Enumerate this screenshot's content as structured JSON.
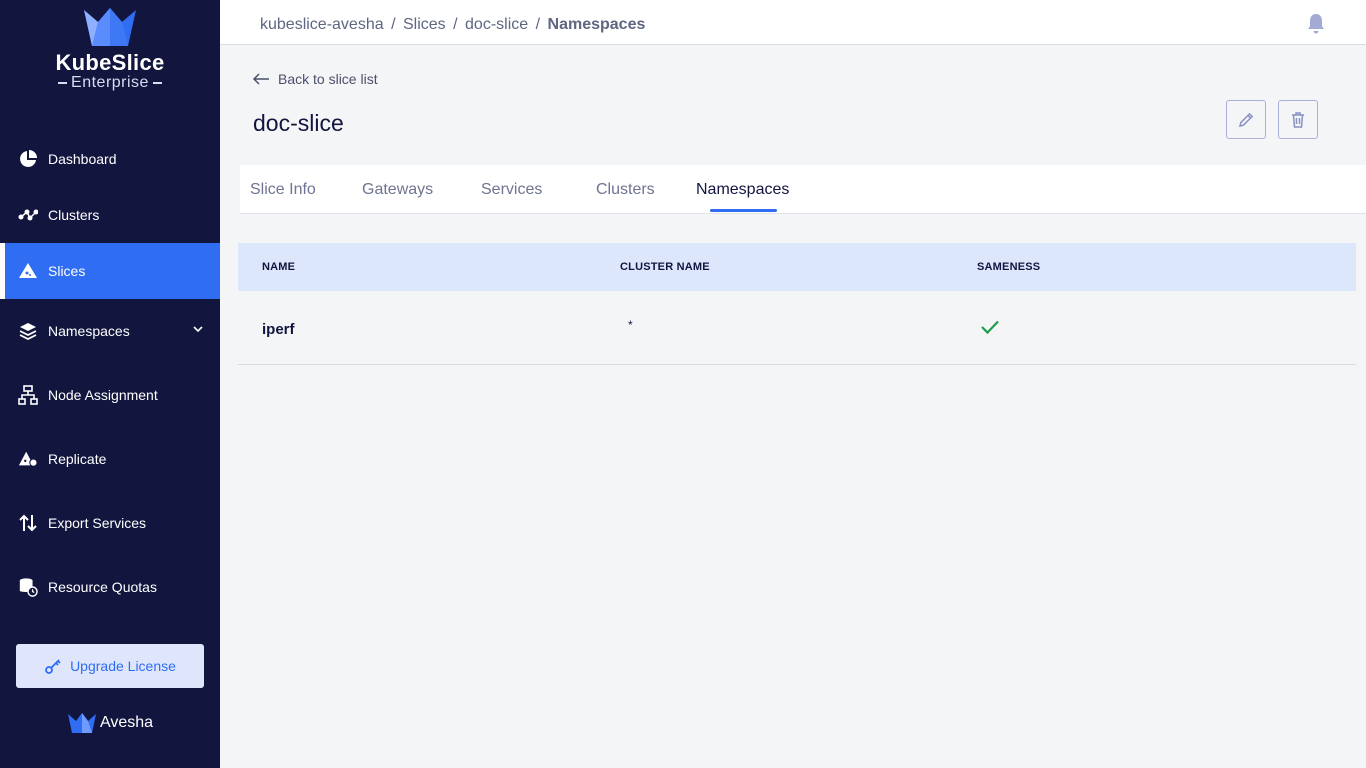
{
  "sidebar": {
    "brand": {
      "title": "KubeSlice",
      "subtitle": "Enterprise"
    },
    "items": [
      {
        "label": "Dashboard",
        "icon": "pie-chart-icon"
      },
      {
        "label": "Clusters",
        "icon": "cluster-nodes-icon"
      },
      {
        "label": "Slices",
        "icon": "slice-icon",
        "active": true
      },
      {
        "label": "Namespaces",
        "icon": "layers-icon",
        "expandable": true
      },
      {
        "label": "Node Assignment",
        "icon": "hierarchy-icon"
      },
      {
        "label": "Replicate",
        "icon": "replicate-icon"
      },
      {
        "label": "Export Services",
        "icon": "up-down-arrows-icon"
      },
      {
        "label": "Resource Quotas",
        "icon": "database-clock-icon"
      }
    ],
    "upgrade_label": "Upgrade License",
    "footer_brand": "Avesha"
  },
  "breadcrumb": {
    "items": [
      "kubeslice-avesha",
      "Slices",
      "doc-slice"
    ],
    "current": "Namespaces",
    "separator": "/"
  },
  "page": {
    "back_label": "Back to slice list",
    "title": "doc-slice"
  },
  "tabs": [
    {
      "label": "Slice Info"
    },
    {
      "label": "Gateways"
    },
    {
      "label": "Services"
    },
    {
      "label": "Clusters"
    },
    {
      "label": "Namespaces",
      "active": true
    }
  ],
  "table": {
    "headers": [
      "NAME",
      "CLUSTER NAME",
      "SAMENESS"
    ],
    "rows": [
      {
        "name": "iperf",
        "cluster": "*",
        "sameness": true
      }
    ]
  },
  "colors": {
    "sidebar_bg": "#12153e",
    "accent": "#2f6df3",
    "table_header_bg": "#dde7fc",
    "check": "#1f9d4c"
  }
}
